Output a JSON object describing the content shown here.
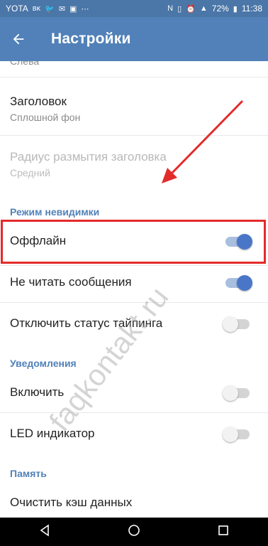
{
  "statusbar": {
    "carrier": "YOTA",
    "battery": "72%",
    "time": "11:38"
  },
  "appbar": {
    "title": "Настройки"
  },
  "rows": {
    "top_secondary": "Слева",
    "header_title": "Заголовок",
    "header_value": "Сплошной фон",
    "blur_title": "Радиус размытия заголовка",
    "blur_value": "Средний"
  },
  "sections": {
    "invisibility": "Режим невидимки",
    "notifications": "Уведомления",
    "memory": "Память"
  },
  "switches": {
    "offline": {
      "label": "Оффлайн",
      "on": true
    },
    "dont_read": {
      "label": "Не читать сообщения",
      "on": true
    },
    "typing": {
      "label": "Отключить статус тайпинга",
      "on": false
    },
    "enable": {
      "label": "Включить",
      "on": false
    },
    "led": {
      "label": "LED индикатор",
      "on": false
    }
  },
  "clear_cache": "Очистить кэш данных",
  "watermark": "faqkontakt.ru",
  "colors": {
    "appbar": "#5181b8",
    "accent": "#4a76c8",
    "highlight": "#e32b2b"
  },
  "icons": {
    "back": "arrow-left",
    "nav_back": "triangle-back",
    "nav_home": "circle-home",
    "nav_recents": "square-recents"
  }
}
